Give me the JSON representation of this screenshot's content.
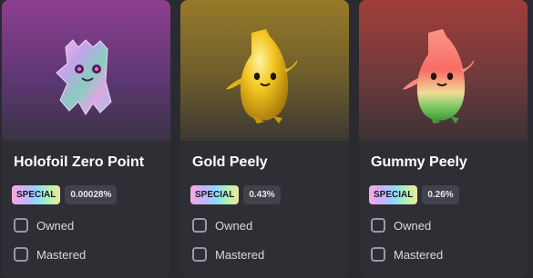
{
  "cards": [
    {
      "name": "Holofoil Zero Point",
      "badge": "SPECIAL",
      "percentage": "0.00028%",
      "owned_label": "Owned",
      "mastered_label": "Mastered",
      "owned": false,
      "mastered": false,
      "image": "holofoil-zero-point-figure"
    },
    {
      "name": "Gold Peely",
      "badge": "SPECIAL",
      "percentage": "0.43%",
      "owned_label": "Owned",
      "mastered_label": "Mastered",
      "owned": false,
      "mastered": false,
      "image": "gold-peely-figure"
    },
    {
      "name": "Gummy Peely",
      "badge": "SPECIAL",
      "percentage": "0.26%",
      "owned_label": "Owned",
      "mastered_label": "Mastered",
      "owned": false,
      "mastered": false,
      "image": "gummy-peely-figure"
    }
  ]
}
